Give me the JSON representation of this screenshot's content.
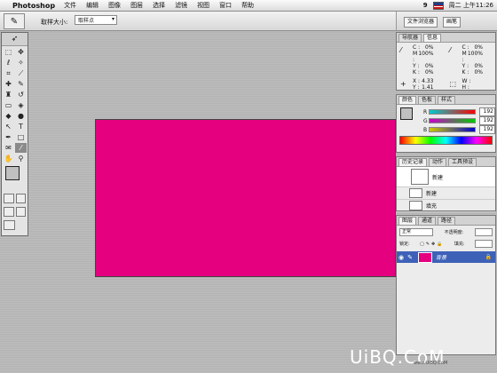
{
  "menubar": {
    "app_name": "Photoshop",
    "items": [
      "文件",
      "编辑",
      "图像",
      "图层",
      "选择",
      "滤镜",
      "视图",
      "窗口",
      "帮助"
    ],
    "clock": "周二 上午11:26",
    "status_glyph": "9"
  },
  "options": {
    "size_label": "取样大小:",
    "size_value": "取样点"
  },
  "palette_well": {
    "tab1": "文件浏览器",
    "tab2": "画笔"
  },
  "navigator_panel": {
    "tabs": [
      "导航器",
      "信息"
    ],
    "left": [
      {
        "k": "C :",
        "v": "0%"
      },
      {
        "k": "M :",
        "v": "100%"
      },
      {
        "k": "Y :",
        "v": "0%"
      },
      {
        "k": "K :",
        "v": "0%"
      }
    ],
    "right": [
      {
        "k": "C :",
        "v": "0%"
      },
      {
        "k": "M :",
        "v": "100%"
      },
      {
        "k": "Y :",
        "v": "0%"
      },
      {
        "k": "K :",
        "v": "0%"
      }
    ],
    "pos": [
      {
        "k": "X :",
        "v": "4.33"
      },
      {
        "k": "Y :",
        "v": "1.41"
      }
    ],
    "size": [
      {
        "k": "W :",
        "v": ""
      },
      {
        "k": "H :",
        "v": ""
      }
    ]
  },
  "color_panel": {
    "tabs": [
      "颜色",
      "色板",
      "样式"
    ],
    "channels": [
      {
        "name": "R",
        "value": "192"
      },
      {
        "name": "G",
        "value": "192"
      },
      {
        "name": "B",
        "value": "192"
      }
    ],
    "foreground": "#c0c0c0"
  },
  "history_panel": {
    "tabs": [
      "历史记录",
      "动作",
      "工具预设"
    ],
    "snapshot": "新建",
    "items": [
      "新建",
      "填充"
    ]
  },
  "layers_panel": {
    "tabs": [
      "图层",
      "通道",
      "路径"
    ],
    "blend": "正常",
    "opacity_label": "不透明度:",
    "lock_label": "锁定:",
    "fill_label": "填充:",
    "layer_name": "背景"
  },
  "canvas": {
    "color": "#e4007f"
  },
  "watermark": {
    "text": "UiBQ.CoM",
    "sub": "www.UiBQ.CoM"
  }
}
